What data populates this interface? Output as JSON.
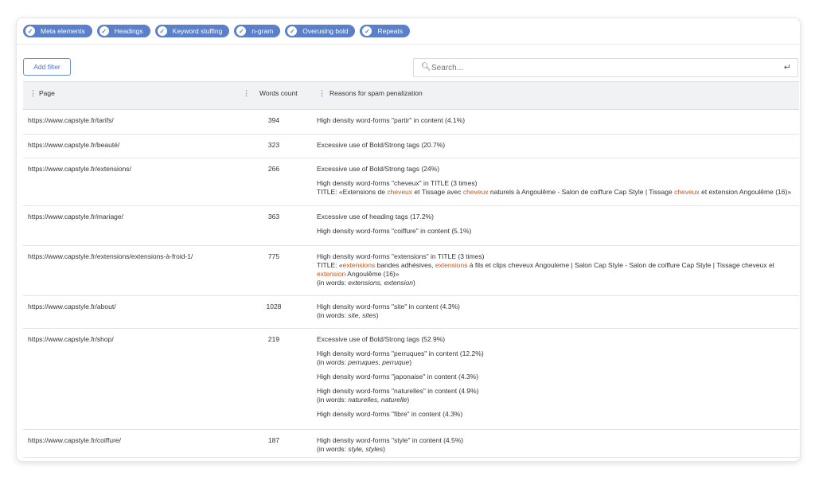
{
  "filters": [
    {
      "label": "Meta elements"
    },
    {
      "label": "Headings"
    },
    {
      "label": "Keyword stuffing"
    },
    {
      "label": "n-gram"
    },
    {
      "label": "Overusing bold"
    },
    {
      "label": "Repeats"
    }
  ],
  "toolbar": {
    "add_filter_label": "Add filter"
  },
  "search": {
    "placeholder": "Search..."
  },
  "columns": {
    "page": "Page",
    "words": "Words count",
    "reasons": "Reasons for spam penalization"
  },
  "colors": {
    "chip": "#5b7fc9",
    "highlight": "#c8581a",
    "header_bg": "#f1f2f4"
  },
  "rows": [
    {
      "page": "https://www.capstyle.fr/tarifs/",
      "count": "394",
      "reasons": [
        {
          "lines": [
            [
              {
                "t": "High density word-forms \"partir\" in content (4.1%)"
              }
            ]
          ]
        }
      ]
    },
    {
      "page": "https://www.capstyle.fr/beauté/",
      "count": "323",
      "reasons": [
        {
          "lines": [
            [
              {
                "t": "Excessive use of Bold/Strong tags (20.7%)"
              }
            ]
          ]
        }
      ]
    },
    {
      "page": "https://www.capstyle.fr/extensions/",
      "count": "266",
      "reasons": [
        {
          "lines": [
            [
              {
                "t": "Excessive use of Bold/Strong tags (24%)"
              }
            ]
          ]
        },
        {
          "lines": [
            [
              {
                "t": "High density word-forms \"cheveux\" in TITLE (3 times)"
              }
            ],
            [
              {
                "t": "TITLE: «Extensions de "
              },
              {
                "t": "cheveux",
                "s": "hl"
              },
              {
                "t": " et Tissage avec "
              },
              {
                "t": "cheveux",
                "s": "hl"
              },
              {
                "t": " naturels à Angoulême - Salon de coiffure Cap Style | Tissage "
              },
              {
                "t": "cheveux",
                "s": "hl"
              },
              {
                "t": " et extension Angoulême (16)»"
              }
            ]
          ]
        }
      ]
    },
    {
      "page": "https://www.capstyle.fr/mariage/",
      "count": "363",
      "reasons": [
        {
          "lines": [
            [
              {
                "t": "Excessive use of heading tags (17.2%)"
              }
            ]
          ]
        },
        {
          "lines": [
            [
              {
                "t": "High density word-forms \"coiffure\" in content (5.1%)"
              }
            ]
          ]
        }
      ]
    },
    {
      "page": "https://www.capstyle.fr/extensions/extensions-à-froid-1/",
      "count": "775",
      "reasons": [
        {
          "lines": [
            [
              {
                "t": "High density word-forms \"extensions\" in TITLE (3 times)"
              }
            ],
            [
              {
                "t": "TITLE: «"
              },
              {
                "t": "extensions",
                "s": "hl"
              },
              {
                "t": " bandes adhésives, "
              },
              {
                "t": "extensions",
                "s": "hl"
              },
              {
                "t": " à fils et clips cheveux Angouleme | Salon Cap Style - Salon de coiffure Cap Style | Tissage cheveux et "
              },
              {
                "t": "extension",
                "s": "hl"
              },
              {
                "t": " Angoulême (16)»"
              }
            ],
            [
              {
                "t": "(in words: "
              },
              {
                "t": "extensions, extension",
                "s": "it"
              },
              {
                "t": ")"
              }
            ]
          ]
        }
      ]
    },
    {
      "page": "https://www.capstyle.fr/about/",
      "count": "1028",
      "reasons": [
        {
          "lines": [
            [
              {
                "t": "High density word-forms \"site\" in content (4.3%)"
              }
            ],
            [
              {
                "t": "(in words: "
              },
              {
                "t": "site, sites",
                "s": "it"
              },
              {
                "t": ")"
              }
            ]
          ]
        }
      ]
    },
    {
      "page": "https://www.capstyle.fr/shop/",
      "count": "219",
      "reasons": [
        {
          "lines": [
            [
              {
                "t": "Excessive use of Bold/Strong tags (52.9%)"
              }
            ]
          ]
        },
        {
          "lines": [
            [
              {
                "t": "High density word-forms \"perruques\" in content (12.2%)"
              }
            ],
            [
              {
                "t": "(in words: "
              },
              {
                "t": "perruques, perruque",
                "s": "it"
              },
              {
                "t": ")"
              }
            ]
          ]
        },
        {
          "lines": [
            [
              {
                "t": "High density word-forms \"japonaise\" in content (4.3%)"
              }
            ]
          ]
        },
        {
          "lines": [
            [
              {
                "t": "High density word-forms \"naturelles\" in content (4.9%)"
              }
            ],
            [
              {
                "t": "(in words: "
              },
              {
                "t": "naturelles, naturelle",
                "s": "it"
              },
              {
                "t": ")"
              }
            ]
          ]
        },
        {
          "lines": [
            [
              {
                "t": "High density word-forms \"fibre\" in content (4.3%)"
              }
            ]
          ]
        }
      ]
    },
    {
      "page": "https://www.capstyle.fr/coiffure/",
      "count": "187",
      "reasons": [
        {
          "lines": [
            [
              {
                "t": "High density word-forms \"style\" in content (4.5%)"
              }
            ],
            [
              {
                "t": "(in words: "
              },
              {
                "t": "style, styles",
                "s": "it"
              },
              {
                "t": ")"
              }
            ]
          ]
        }
      ]
    }
  ]
}
